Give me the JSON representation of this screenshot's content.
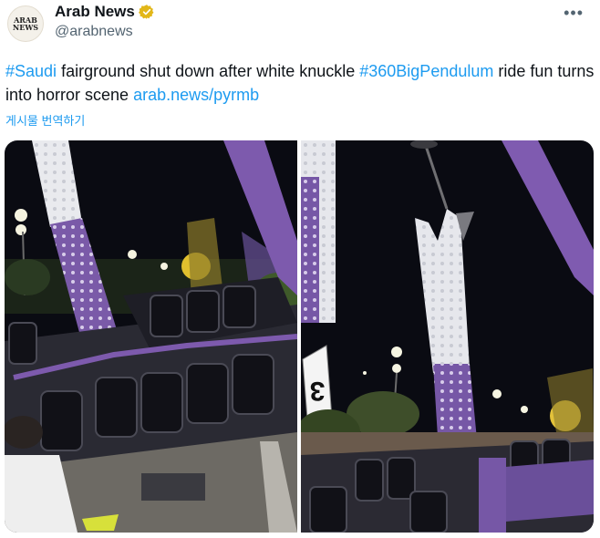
{
  "author": {
    "name": "Arab News",
    "handle": "@arabnews",
    "avatar_text": "ARAB\nNEWS",
    "verified_icon": "verified-badge-icon"
  },
  "menu_icon_text": "•••",
  "tweet": {
    "hashtag1": "#Saudi",
    "text1": " fairground shut down after white knuckle ",
    "hashtag2": "#360BigPendulum",
    "text2": " ride fun turns into horror scene ",
    "link": "arab.news/pyrmb"
  },
  "translate_label": "게시물 번역하기",
  "media": {
    "photo2_sign": "3"
  },
  "colors": {
    "link": "#1d9bf0",
    "text": "#0f1419",
    "secondary": "#536471",
    "verified_gold": "#e2b719"
  }
}
